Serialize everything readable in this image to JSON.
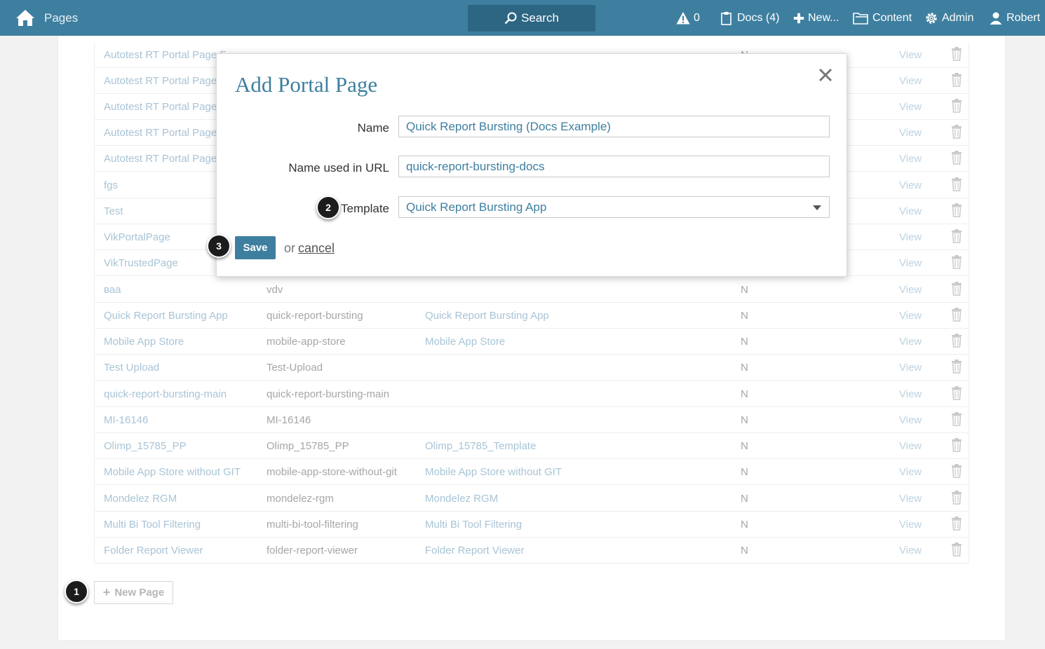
{
  "topbar": {
    "title": "Pages",
    "search_label": "Search",
    "alerts_count": "0",
    "docs_label": "Docs (4)",
    "new_label": "New...",
    "content_label": "Content",
    "admin_label": "Admin",
    "user_label": "Robert"
  },
  "table": {
    "rows": [
      {
        "name": "Autotest RT Portal Page F",
        "url": "",
        "template": "",
        "flag": "N",
        "view": "View"
      },
      {
        "name": "Autotest RT Portal Page",
        "url": "",
        "template": "",
        "flag": "",
        "view": "View"
      },
      {
        "name": "Autotest RT Portal Page",
        "url": "",
        "template": "",
        "flag": "",
        "view": "View"
      },
      {
        "name": "Autotest RT Portal Page",
        "url": "",
        "template": "",
        "flag": "",
        "view": "View"
      },
      {
        "name": "Autotest RT Portal Page",
        "url": "",
        "template": "",
        "flag": "",
        "view": "View"
      },
      {
        "name": "fgs",
        "url": "",
        "template": "",
        "flag": "",
        "view": "View"
      },
      {
        "name": "Test",
        "url": "",
        "template": "",
        "flag": "",
        "view": "View"
      },
      {
        "name": "VikPortalPage",
        "url": "",
        "template": "",
        "flag": "",
        "view": "View"
      },
      {
        "name": "VikTrustedPage",
        "url": "",
        "template": "",
        "flag": "",
        "view": "View"
      },
      {
        "name": "ваа",
        "url": "vdv",
        "template": "",
        "flag": "N",
        "view": "View"
      },
      {
        "name": "Quick Report Bursting App",
        "url": "quick-report-bursting",
        "template": "Quick Report Bursting App",
        "flag": "N",
        "view": "View"
      },
      {
        "name": "Mobile App Store",
        "url": "mobile-app-store",
        "template": "Mobile App Store",
        "flag": "N",
        "view": "View"
      },
      {
        "name": "Test Upload",
        "url": "Test-Upload",
        "template": "",
        "flag": "N",
        "view": "View"
      },
      {
        "name": "quick-report-bursting-main",
        "url": "quick-report-bursting-main",
        "template": "",
        "flag": "N",
        "view": "View"
      },
      {
        "name": "MI-16146",
        "url": "MI-16146",
        "template": "",
        "flag": "N",
        "view": "View"
      },
      {
        "name": "Olimp_15785_PP",
        "url": "Olimp_15785_PP",
        "template": "Olimp_15785_Template",
        "flag": "N",
        "view": "View"
      },
      {
        "name": "Mobile App Store without GIT",
        "url": "mobile-app-store-without-git",
        "template": "Mobile App Store without GIT",
        "flag": "N",
        "view": "View"
      },
      {
        "name": "Mondelez RGM",
        "url": "mondelez-rgm",
        "template": "Mondelez RGM",
        "flag": "N",
        "view": "View"
      },
      {
        "name": "Multi Bi Tool Filtering",
        "url": "multi-bi-tool-filtering",
        "template": "Multi Bi Tool Filtering",
        "flag": "N",
        "view": "View"
      },
      {
        "name": "Folder Report Viewer",
        "url": "folder-report-viewer",
        "template": "Folder Report Viewer",
        "flag": "N",
        "view": "View"
      }
    ]
  },
  "new_page_label": "New Page",
  "badges": {
    "one": "1",
    "two": "2",
    "three": "3"
  },
  "modal": {
    "title": "Add Portal Page",
    "name_label": "Name",
    "name_value": "Quick Report Bursting (Docs Example)",
    "url_label": "Name used in URL",
    "url_value": "quick-report-bursting-docs",
    "template_label": "Template",
    "template_value": "Quick Report Bursting App",
    "save_label": "Save",
    "or_label": "or",
    "cancel_label": "cancel"
  },
  "colors": {
    "accent": "#3e7fa0",
    "topbar": "#3e7fa0",
    "link_faded": "#a8c4d6"
  }
}
